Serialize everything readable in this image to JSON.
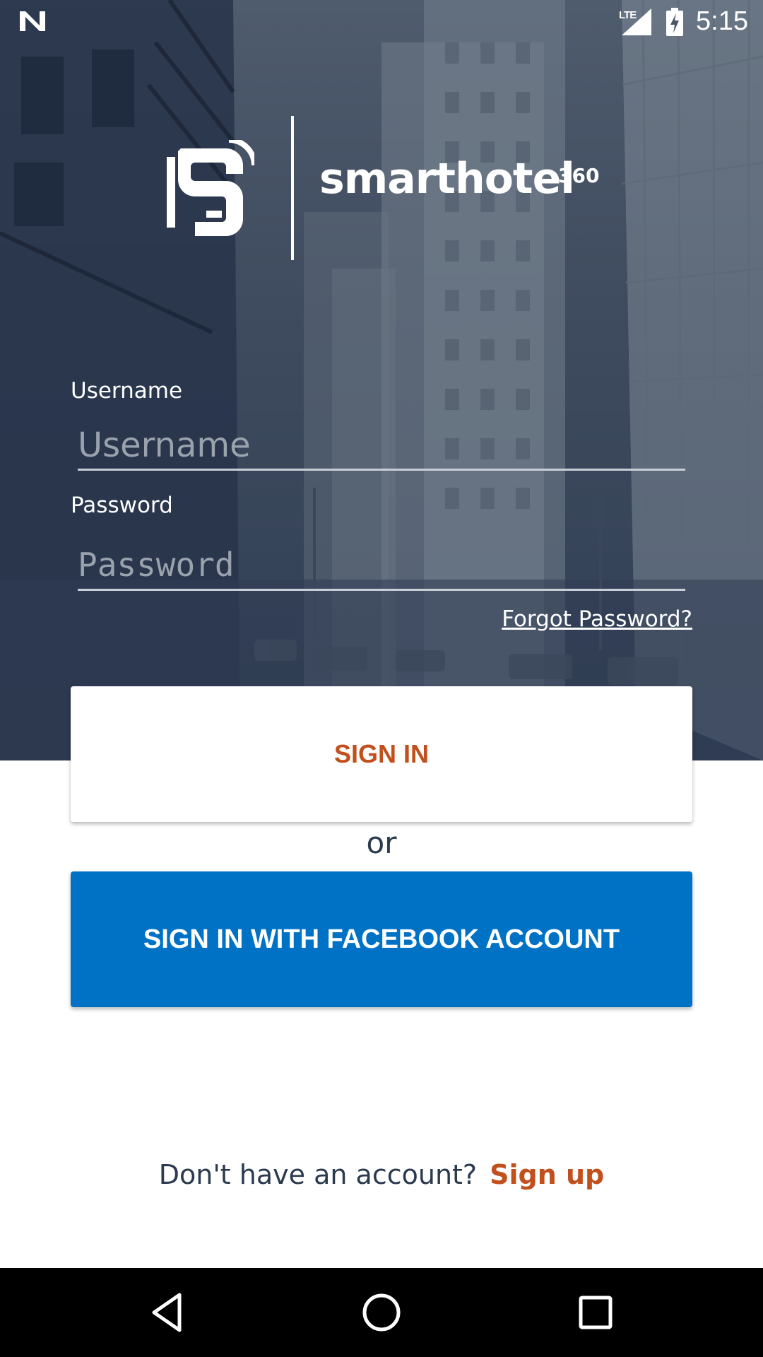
{
  "status_bar": {
    "network_type": "LTE",
    "time": "5:15",
    "icons": [
      "n-logo-icon",
      "signal-icon",
      "battery-charging-icon"
    ]
  },
  "brand": {
    "name": "smarthotel",
    "superscript": "360",
    "logo_icon": "smarthotel-logo-icon"
  },
  "login_form": {
    "username_label": "Username",
    "username_placeholder": "Username",
    "username_value": "",
    "password_label": "Password",
    "password_placeholder": "Password",
    "password_value": "",
    "forgot_password": "Forgot Password?"
  },
  "actions": {
    "sign_in": "SIGN IN",
    "or": "or",
    "facebook": "SIGN IN WITH FACEBOOK ACCOUNT"
  },
  "signup": {
    "prompt": "Don't have an account?",
    "link": "Sign up"
  },
  "nav_bar": {
    "icons": [
      "back-icon",
      "home-icon",
      "recents-icon"
    ]
  },
  "colors": {
    "accent_orange": "#c2501d",
    "facebook_blue": "#0072c6",
    "hero_dark": "#2f3d53",
    "text_dark": "#2b3a4e"
  }
}
